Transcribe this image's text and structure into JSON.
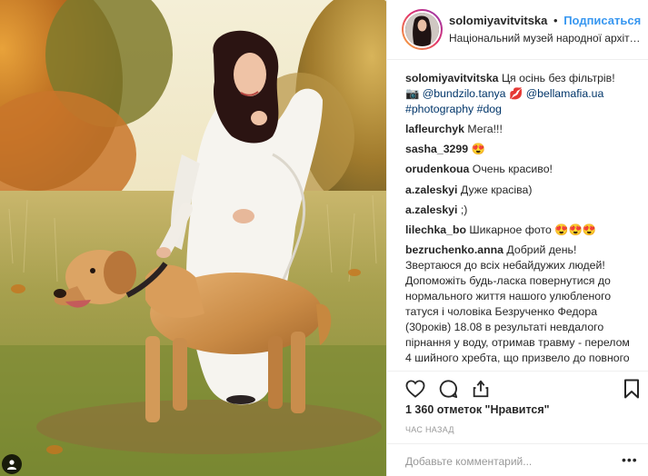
{
  "header": {
    "username": "solomiyavitvitska",
    "separator": "•",
    "follow_label": "Подписаться",
    "location": "Національний музей народної архітекту..."
  },
  "caption": {
    "user": "solomiyavitvitska",
    "text": "Ця осінь без фільтрів!",
    "line2_prefix": "📷",
    "mention1": "@bundzilo.tanya",
    "mention1_suffix": "💋",
    "mention2": "@bellamafia.ua",
    "hashtags": "#photography #dog"
  },
  "comments": [
    {
      "user": "lafleurchyk",
      "text": "Мега!!!"
    },
    {
      "user": "sasha_3299",
      "text": "😍"
    },
    {
      "user": "orudenkoua",
      "text": "Очень красиво!"
    },
    {
      "user": "a.zaleskyi",
      "text": "Дуже красіва)"
    },
    {
      "user": "a.zaleskyi",
      "text": ";)"
    },
    {
      "user": "lilechka_bo",
      "text": "Шикарное фото 😍😍😍"
    },
    {
      "user": "bezruchenko.anna",
      "text": "Добрий день! Звертаюся до всіх небайдужих людей! Допоможіть будь-ласка повернутися до нормального життя нашого улюбленого татуся і чоловіка Безрученко Федора (30років) 18.08 в результаті невдалого пірнання у воду, отримав травму - перелом 4 шийного хребта, що призвело до повного паралічу, додатково це"
    }
  ],
  "actions": {
    "like_icon": "heart-icon",
    "comment_icon": "comment-icon",
    "share_icon": "share-icon",
    "save_icon": "bookmark-icon"
  },
  "likes_text": "1 360 отметок \"Нравится\"",
  "timestamp": "час назад",
  "add_comment": {
    "placeholder": "Добавьте комментарий..."
  },
  "more_label": "•••",
  "colors": {
    "link": "#3897f0",
    "mention": "#003569",
    "border": "#efefef",
    "muted": "#999999"
  }
}
